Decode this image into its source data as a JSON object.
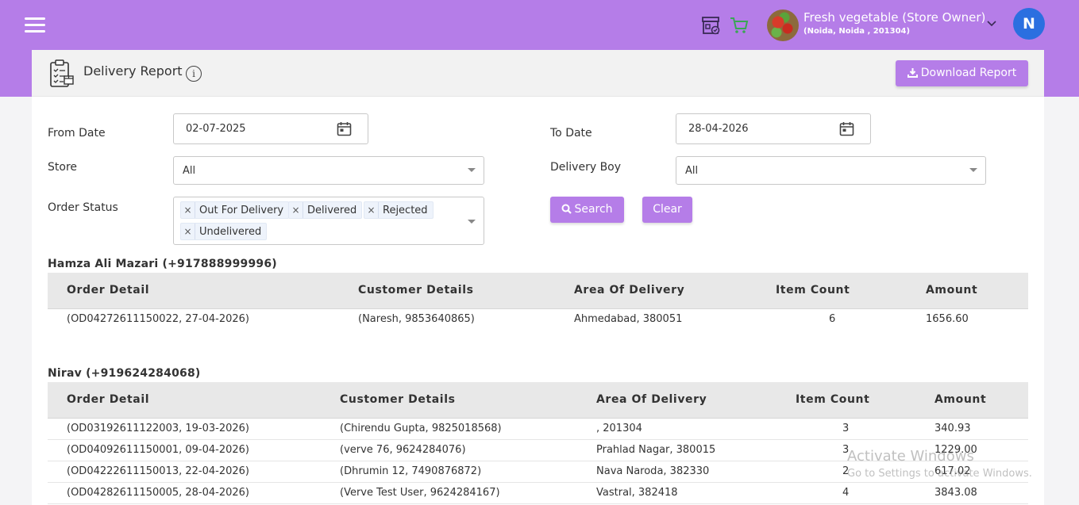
{
  "header": {
    "store_name": "Fresh vegetable (Store Owner)",
    "store_address": "(Noida, Noida , 201304)",
    "user_initial": "N",
    "brand_color": "#b57de8"
  },
  "report": {
    "title": "Delivery Report",
    "info_glyph": "i",
    "download_label": "Download Report"
  },
  "filters": {
    "from_date_label": "From Date",
    "from_date_value": "02-07-2025",
    "to_date_label": "To Date",
    "to_date_value": "28-04-2026",
    "store_label": "Store",
    "store_value": "All",
    "delivery_boy_label": "Delivery Boy",
    "delivery_boy_value": "All",
    "order_status_label": "Order Status",
    "order_status_chips": [
      "Out For Delivery",
      "Delivered",
      "Rejected",
      "Undelivered"
    ],
    "search_label": "Search",
    "clear_label": "Clear"
  },
  "groups": [
    {
      "title": "Hamza Ali Mazari (+917888999996)",
      "columns": [
        "Order Detail",
        "Customer Details",
        "Area Of Delivery",
        "Item Count",
        "Amount"
      ],
      "rows": [
        [
          "(OD04272611150022, 27-04-2026)",
          "(Naresh, 9853640865)",
          "Ahmedabad, 380051",
          "6",
          "1656.60"
        ]
      ]
    },
    {
      "title": "Nirav (+919624284068)",
      "columns": [
        "Order Detail",
        "Customer Details",
        "Area Of Delivery",
        "Item Count",
        "Amount"
      ],
      "rows": [
        [
          "(OD03192611122003, 19-03-2026)",
          "(Chirendu Gupta, 9825018568)",
          ", 201304",
          "3",
          "340.93"
        ],
        [
          "(OD04092611150001, 09-04-2026)",
          "(verve 76, 9624284076)",
          "Prahlad Nagar, 380015",
          "3",
          "1229.00"
        ],
        [
          "(OD04222611150013, 22-04-2026)",
          "(Dhrumin 12, 7490876872)",
          "Nava Naroda, 382330",
          "2",
          "617.02"
        ],
        [
          "(OD04282611150005, 28-04-2026)",
          "(Verve Test User, 9624284167)",
          "Vastral, 382418",
          "4",
          "3843.08"
        ]
      ]
    }
  ],
  "watermark": {
    "line1": "Activate Windows",
    "line2": "Go to Settings to activate Windows."
  }
}
